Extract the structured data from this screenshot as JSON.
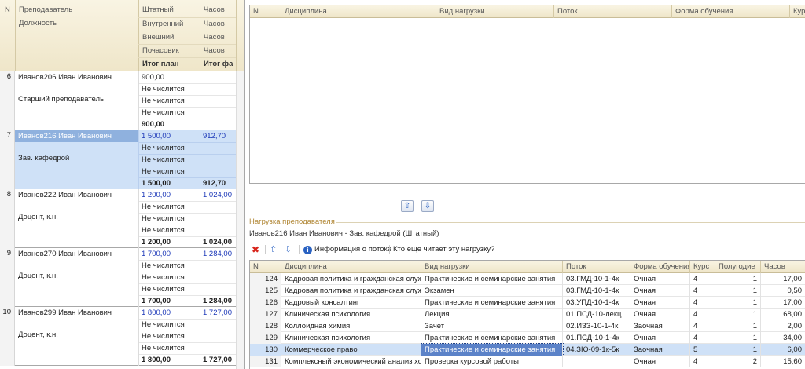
{
  "left_grid": {
    "headers": {
      "n": "N",
      "teacher": "Преподаватель",
      "position": "Должность",
      "staff": "Штатный",
      "internal": "Внутренний",
      "external": "Внешний",
      "hourly": "Почасовик",
      "total_plan": "Итог план",
      "hours": "Часов",
      "hours2": "Часов",
      "hours3": "Часов",
      "hours4": "Часов",
      "total_fact": "Итог фа"
    },
    "rows": [
      {
        "n": "6",
        "name": "Иванов206 Иван Иванович",
        "position": "Старший преподаватель",
        "staff": "900,00",
        "internal": "Не числится",
        "external": "Не числится",
        "hourly": "Не числится",
        "total_plan": "900,00",
        "hours_staff": "",
        "total_fact": "",
        "selected": false
      },
      {
        "n": "7",
        "name": "Иванов216 Иван Иванович",
        "position": "Зав. кафедрой",
        "staff": "1 500,00",
        "internal": "Не числится",
        "external": "Не числится",
        "hourly": "Не числится",
        "total_plan": "1 500,00",
        "hours_staff": "912,70",
        "total_fact": "912,70",
        "selected": true
      },
      {
        "n": "8",
        "name": "Иванов222 Иван Иванович",
        "position": "Доцент, к.н.",
        "staff": "1 200,00",
        "internal": "Не числится",
        "external": "Не числится",
        "hourly": "Не числится",
        "total_plan": "1 200,00",
        "hours_staff": "1 024,00",
        "total_fact": "1 024,00",
        "selected": false
      },
      {
        "n": "9",
        "name": "Иванов270 Иван Иванович",
        "position": "Доцент, к.н.",
        "staff": "1 700,00",
        "internal": "Не числится",
        "external": "Не числится",
        "hourly": "Не числится",
        "total_plan": "1 700,00",
        "hours_staff": "1 284,00",
        "total_fact": "1 284,00",
        "selected": false
      },
      {
        "n": "10",
        "name": "Иванов299 Иван Иванович",
        "position": "Доцент, к.н.",
        "staff": "1 800,00",
        "internal": "Не числится",
        "external": "Не числится",
        "hourly": "Не числится",
        "total_plan": "1 800,00",
        "hours_staff": "1 727,00",
        "total_fact": "1 727,00",
        "selected": false
      }
    ]
  },
  "top_grid": {
    "headers": [
      "N",
      "Дисциплина",
      "Вид нагрузки",
      "Поток",
      "Форма обучения",
      "Курс"
    ]
  },
  "section": {
    "title": "Нагрузка преподавателя",
    "teacher_line": "Иванов216 Иван Иванович - Зав. кафедрой (Штатный)"
  },
  "toolbar": {
    "delete_icon": "✖",
    "up_icon": "⇧",
    "down_icon": "⇩",
    "info_icon": "i",
    "info_label": "Информация о потоке",
    "who_label": "Кто еще читает эту нагрузку?"
  },
  "bottom_grid": {
    "headers": [
      "N",
      "Дисциплина",
      "Вид нагрузки",
      "Поток",
      "Форма обучения",
      "Курс",
      "Полугодие",
      "Часов"
    ],
    "rows": [
      {
        "n": "124",
        "disc": "Кадровая политика и гражданская служ...",
        "kind": "Практические и семинарские занятия",
        "stream": "03.ГМД-10-1-4к",
        "form": "Очная",
        "course": "4",
        "half": "1",
        "hours": "17,00",
        "selected": false
      },
      {
        "n": "125",
        "disc": "Кадровая политика и гражданская служ...",
        "kind": "Экзамен",
        "stream": "03.ГМД-10-1-4к",
        "form": "Очная",
        "course": "4",
        "half": "1",
        "hours": "0,50",
        "selected": false
      },
      {
        "n": "126",
        "disc": "Кадровый консалтинг",
        "kind": "Практические и семинарские занятия",
        "stream": "03.УПД-10-1-4к",
        "form": "Очная",
        "course": "4",
        "half": "1",
        "hours": "17,00",
        "selected": false
      },
      {
        "n": "127",
        "disc": "Клиническая психология",
        "kind": "Лекция",
        "stream": "01.ПСД-10-лекц",
        "form": "Очная",
        "course": "4",
        "half": "1",
        "hours": "68,00",
        "selected": false
      },
      {
        "n": "128",
        "disc": "Коллоидная химия",
        "kind": "Зачет",
        "stream": "02.ИЗЗ-10-1-4к",
        "form": "Заочная",
        "course": "4",
        "half": "1",
        "hours": "2,00",
        "selected": false
      },
      {
        "n": "129",
        "disc": "Клиническая психология",
        "kind": "Практические и семинарские занятия",
        "stream": "01.ПСД-10-1-4к",
        "form": "Очная",
        "course": "4",
        "half": "1",
        "hours": "34,00",
        "selected": false
      },
      {
        "n": "130",
        "disc": "Коммерческое право",
        "kind": "Практические и семинарские занятия",
        "stream": "04.ЗЮ-09-1к-5к",
        "form": "Заочная",
        "course": "5",
        "half": "1",
        "hours": "6,00",
        "selected": true
      },
      {
        "n": "131",
        "disc": "Комплексный экономический анализ хо...",
        "kind": "Проверка курсовой работы",
        "stream": "",
        "form": "Очная",
        "course": "4",
        "half": "2",
        "hours": "15,60",
        "selected": false
      }
    ]
  }
}
